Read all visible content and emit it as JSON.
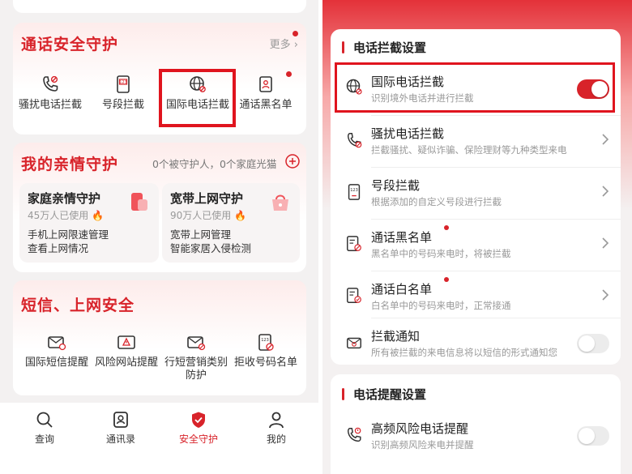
{
  "left": {
    "call_security": {
      "title": "通话安全守护",
      "more": "更多",
      "items": [
        {
          "label": "骚扰电话拦截",
          "icon": "harass-call-icon"
        },
        {
          "label": "号段拦截",
          "icon": "number-range-icon"
        },
        {
          "label": "国际电话拦截",
          "icon": "globe-icon"
        },
        {
          "label": "通话黑名单",
          "icon": "blacklist-icon"
        }
      ]
    },
    "family": {
      "title": "我的亲情守护",
      "guardians": "0个被守护人，0个家庭光猫",
      "cards": [
        {
          "title": "家庭亲情守护",
          "users": "45万人已使用",
          "desc1": "手机上网限速管理",
          "desc2": "查看上网情况"
        },
        {
          "title": "宽带上网守护",
          "users": "90万人已使用",
          "desc1": "宽带上网管理",
          "desc2": "智能家居入侵检测"
        }
      ]
    },
    "sms": {
      "title": "短信、上网安全",
      "items": [
        {
          "label": "国际短信提醒",
          "icon": "intl-sms-icon"
        },
        {
          "label": "风险网站提醒",
          "icon": "risk-site-icon"
        },
        {
          "label": "行短营销类别防护",
          "icon": "marketing-sms-icon"
        },
        {
          "label": "拒收号码名单",
          "icon": "reject-number-icon"
        }
      ]
    },
    "tabs": [
      {
        "label": "查询",
        "icon": "search-icon"
      },
      {
        "label": "通讯录",
        "icon": "contacts-icon"
      },
      {
        "label": "安全守护",
        "icon": "shield-icon"
      },
      {
        "label": "我的",
        "icon": "person-icon"
      }
    ],
    "accent": "#d8232a"
  },
  "right": {
    "section1": "电话拦截设置",
    "rows": [
      {
        "title": "国际电话拦截",
        "desc": "识别境外电话并进行拦截",
        "control": "toggle-on"
      },
      {
        "title": "骚扰电话拦截",
        "desc": "拦截骚扰、疑似诈骗、保险理财等九种类型来电",
        "control": "chevron"
      },
      {
        "title": "号段拦截",
        "desc": "根据添加的自定义号段进行拦截",
        "control": "chevron"
      },
      {
        "title": "通话黑名单",
        "desc": "黑名单中的号码来电时，将被拦截",
        "control": "chevron"
      },
      {
        "title": "通话白名单",
        "desc": "白名单中的号码来电时，正常接通",
        "control": "chevron"
      },
      {
        "title": "拦截通知",
        "desc": "所有被拦截的来电信息将以短信的形式通知您",
        "control": "toggle-off"
      }
    ],
    "section2": "电话提醒设置",
    "rows2": [
      {
        "title": "高频风险电话提醒",
        "desc": "识别高频风险来电并提醒",
        "control": "toggle-off"
      }
    ]
  }
}
